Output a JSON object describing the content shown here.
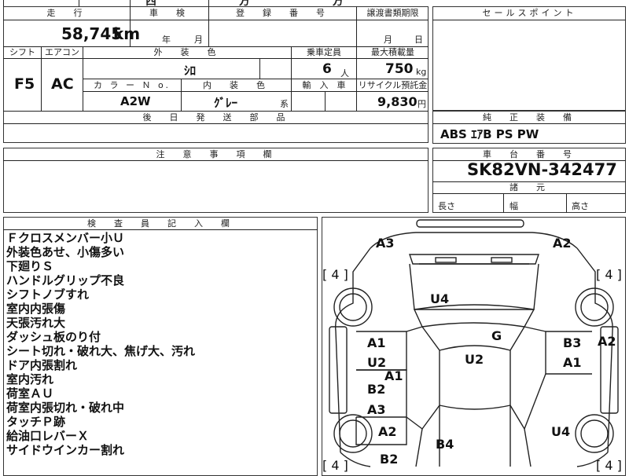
{
  "top_fragment": "西 方 方",
  "header": {
    "mileage_label": "走　行",
    "inspection_label": "車　検",
    "registration_label": "登　録　番　号",
    "transfer_deadline_label": "譲渡書類期限",
    "sales_point_label": "セールスポイント"
  },
  "mileage": {
    "value": "58,745",
    "unit": "km"
  },
  "inspection": {
    "year_unit": "年",
    "month_unit": "月"
  },
  "transfer_deadline": {
    "month_unit": "月",
    "day_unit": "日"
  },
  "row2_labels": {
    "shift": "シフト",
    "aircon": "エアコン",
    "exterior_color": "外　装　色",
    "capacity": "乗車定員",
    "max_load": "最大積載量"
  },
  "shift": "F5",
  "aircon": "AC",
  "exterior_color": "ｼﾛ",
  "capacity": {
    "value": "6",
    "unit": "人"
  },
  "max_load": {
    "value": "750",
    "unit": "kg"
  },
  "row3_labels": {
    "color_no": "カ ラ ー Ｎ o.",
    "interior_color": "内　装　色",
    "import": "輸　入　車",
    "recycle": "リサイクル預託金"
  },
  "color_no": "A2W",
  "interior_color": {
    "value": "ｸﾞﾚｰ",
    "suffix": "系"
  },
  "recycle": {
    "value": "9,830",
    "unit": "円"
  },
  "later_parts_label": "後　日　発　送　部　品",
  "standard_equipment_label": "純　正　装　備",
  "standard_equipment": "ABS ｴｱB PS PW",
  "caution_label": "注　意　事　項　欄",
  "chassis_label": "車　台　番　号",
  "chassis_number": "SK82VN-342477",
  "dimensions_label": "諸　元",
  "dimensions": {
    "length": "長さ",
    "width": "幅",
    "height": "高さ"
  },
  "inspector_label": "検　査　員　記　入　欄",
  "inspector_notes": [
    "Ｆクロスメンバー小Ｕ",
    "外装色あせ、小傷多い",
    "下廻りＳ",
    "ハンドルグリップ不良",
    "シフトノブすれ",
    "室内内張傷",
    "天張汚れ大",
    "ダッシュ板のり付",
    "シート切れ・破れ大、焦げ大、汚れ",
    "ドア内張割れ",
    "室内汚れ",
    "荷室ＡＵ",
    "荷室内張切れ・破れ中",
    "タッチＰ跡",
    "給油口レバーＸ",
    "サイドウインカー割れ"
  ],
  "diagram": {
    "tires": [
      "[ 4 ]",
      "[ 4 ]",
      "[ 4 ]",
      "[ 4 ]"
    ],
    "marks": {
      "front_left": "A3",
      "front_right": "A2",
      "hood": "U4",
      "windshield": "G",
      "left_door_1": "A1",
      "left_door_2": "U2",
      "left_sill": "A1",
      "left_rear_1": "B2",
      "left_rear_2": "A3",
      "roof": "U2",
      "right_door_1": "B3",
      "right_door_2": "A1",
      "right_side": "A2",
      "left_quarter": "A2",
      "right_quarter": "U4",
      "rear": "B4",
      "rear_left": "B2"
    }
  }
}
